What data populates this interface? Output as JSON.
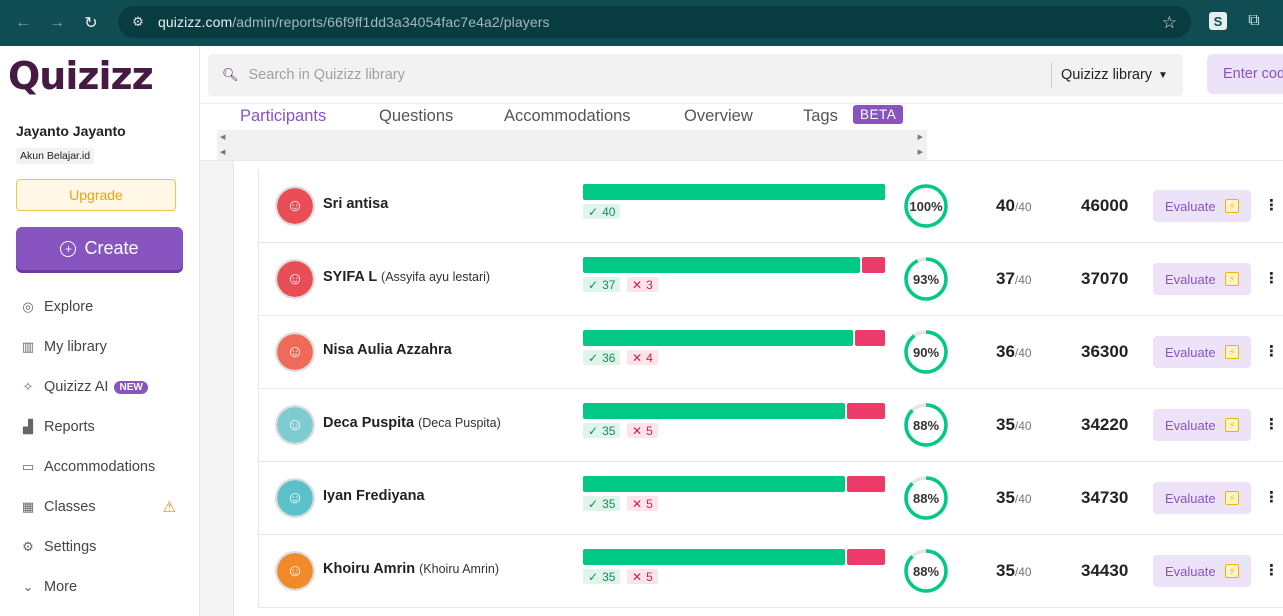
{
  "browser": {
    "url_host": "quizizz.com",
    "url_path": "/admin/reports/66f9ff1dd3a34054fac7e4a2/players"
  },
  "sidebar": {
    "logo": "Quizizz",
    "user_name": "Jayanto Jayanto",
    "org": "Akun Belajar.id",
    "upgrade_label": "Upgrade",
    "create_label": "Create",
    "nav": [
      {
        "label": "Explore",
        "icon": "compass-icon"
      },
      {
        "label": "My library",
        "icon": "library-icon"
      },
      {
        "label": "Quizizz AI",
        "icon": "sparkle-icon",
        "badge": "NEW"
      },
      {
        "label": "Reports",
        "icon": "chart-icon"
      },
      {
        "label": "Accommodations",
        "icon": "accommodations-icon"
      },
      {
        "label": "Classes",
        "icon": "classes-icon",
        "warning": true
      },
      {
        "label": "Settings",
        "icon": "gear-icon"
      },
      {
        "label": "More",
        "icon": "chevron-down-icon"
      }
    ]
  },
  "topbar": {
    "search_placeholder": "Search in Quizizz library",
    "library_select": "Quizizz library",
    "enter_code": "Enter code"
  },
  "tabs": {
    "items": [
      "Participants",
      "Questions",
      "Accommodations",
      "Overview",
      "Tags"
    ],
    "active": "Participants",
    "beta_badge": "BETA"
  },
  "participants": [
    {
      "name": "Sri antisa",
      "alias": "",
      "correct": "40",
      "incorrect": "0",
      "accuracy": "100%",
      "accuracy_value": 100,
      "score": "40",
      "total": "/40",
      "points": "46000",
      "evaluate": "Evaluate",
      "avatar_color": "#e94d55"
    },
    {
      "name": "SYIFA L",
      "alias": "(Assyifa ayu lestari)",
      "correct": "37",
      "incorrect": "3",
      "accuracy": "93%",
      "accuracy_value": 93,
      "score": "37",
      "total": "/40",
      "points": "37070",
      "evaluate": "Evaluate",
      "avatar_color": "#e94d55"
    },
    {
      "name": "Nisa Aulia Azzahra",
      "alias": "",
      "correct": "36",
      "incorrect": "4",
      "accuracy": "90%",
      "accuracy_value": 90,
      "score": "36",
      "total": "/40",
      "points": "36300",
      "evaluate": "Evaluate",
      "avatar_color": "#f06a5a"
    },
    {
      "name": "Deca Puspita",
      "alias": "(Deca Puspita)",
      "correct": "35",
      "incorrect": "5",
      "accuracy": "88%",
      "accuracy_value": 88,
      "score": "35",
      "total": "/40",
      "points": "34220",
      "evaluate": "Evaluate",
      "avatar_color": "#7ecbd1"
    },
    {
      "name": "Iyan Frediyana",
      "alias": "",
      "correct": "35",
      "incorrect": "5",
      "accuracy": "88%",
      "accuracy_value": 88,
      "score": "35",
      "total": "/40",
      "points": "34730",
      "evaluate": "Evaluate",
      "avatar_color": "#5bc2c9"
    },
    {
      "name": "Khoiru Amrin",
      "alias": "(Khoiru Amrin)",
      "correct": "35",
      "incorrect": "5",
      "accuracy": "88%",
      "accuracy_value": 88,
      "score": "35",
      "total": "/40",
      "points": "34430",
      "evaluate": "Evaluate",
      "avatar_color": "#f08a2a"
    }
  ],
  "colors": {
    "accent": "#8854c0",
    "correct": "#00c985",
    "incorrect": "#ec3b68",
    "chrome": "#0f4d53"
  }
}
